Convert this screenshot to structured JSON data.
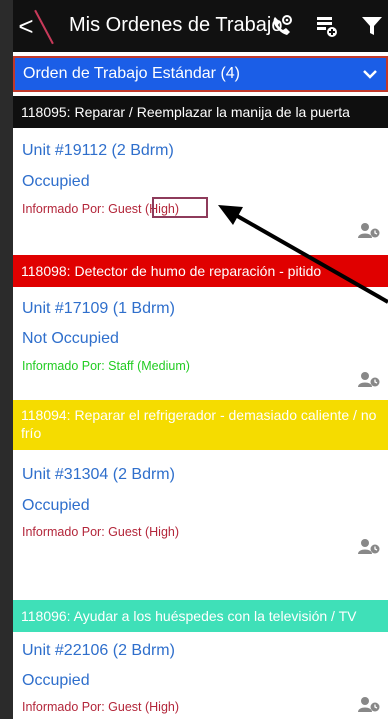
{
  "header": {
    "back_glyph": "<",
    "title": "Mis Ordenes de Trabajo",
    "icons": [
      "phone-settings-icon",
      "list-add-icon",
      "filter-icon"
    ]
  },
  "section": {
    "label": "Orden de Trabajo Estándar (4)",
    "color": "#1b5ee7"
  },
  "orders": [
    {
      "header": "118095: Reparar / Reemplazar la manija de la puerta",
      "header_color": "#0f0f0f",
      "unit": "Unit #19112 (2 Bdrm)",
      "status": "Occupied",
      "reported_prefix": "Informado Por: Guest ",
      "priority": "(High)",
      "reported_color": "#b3263a"
    },
    {
      "header": "118098: Detector de humo de reparación - pitido",
      "header_color": "#e00000",
      "unit": "Unit #17109 (1 Bdrm)",
      "status": "Not Occupied",
      "reported_prefix": "Informado Por: Staff ",
      "priority": " (Medium)",
      "reported_color": "#22cc22"
    },
    {
      "header": "118094: Reparar el refrigerador - demasiado caliente / no frío",
      "header_color": "#f5dc00",
      "unit": "Unit #31304 (2 Bdrm)",
      "status": "Occupied",
      "reported_prefix": "Informado Por: Guest ",
      "priority": " (High)",
      "reported_color": "#b3263a"
    },
    {
      "header": "118096: Ayudar a los huéspedes con la televisión / TV",
      "header_color": "#3fe0b8",
      "unit": "Unit #22106 (2 Bdrm)",
      "status": "Occupied",
      "reported_prefix": "Informado Por: Guest ",
      "priority": " (High)",
      "reported_color": "#b3263a"
    }
  ]
}
